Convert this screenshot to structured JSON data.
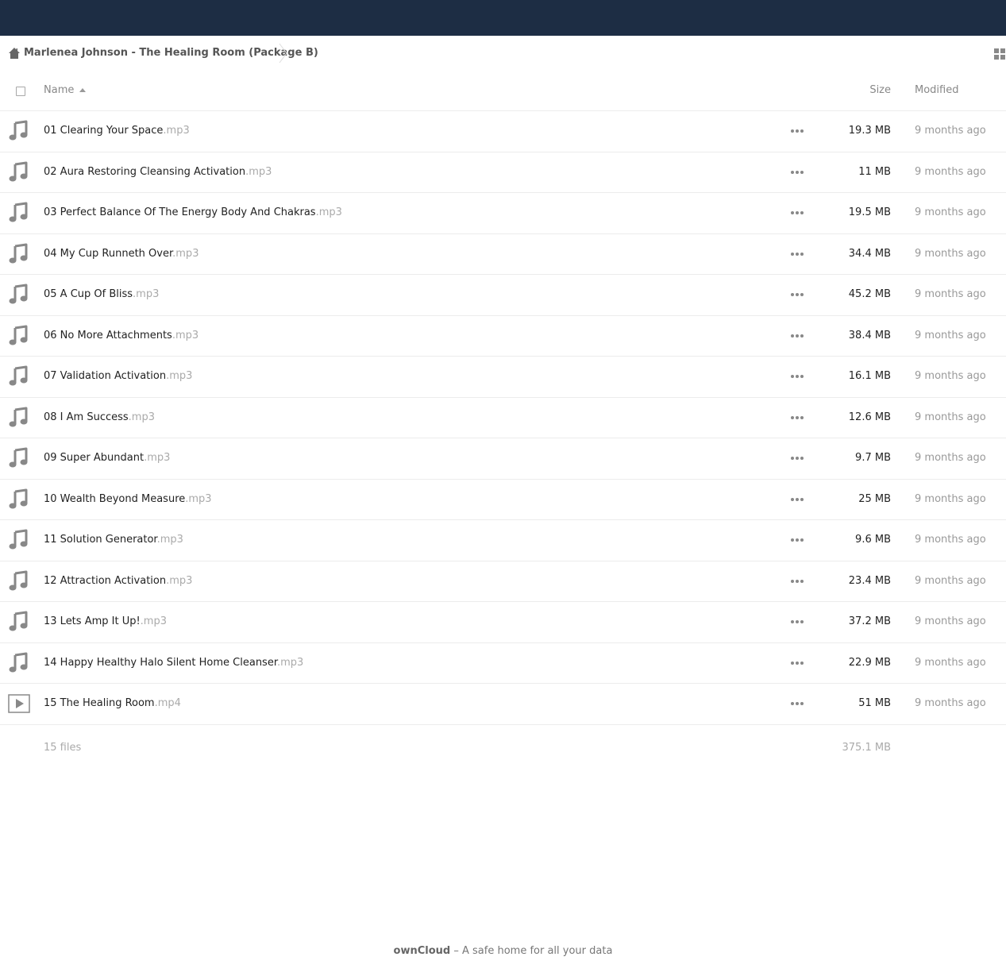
{
  "breadcrumb": {
    "home_icon": "home-icon",
    "folder": "Marlenea Johnson - The Healing Room (Package B)"
  },
  "table": {
    "headers": {
      "name": "Name",
      "size": "Size",
      "modified": "Modified"
    },
    "files": [
      {
        "name": "01 Clearing Your Space",
        "ext": ".mp3",
        "size": "19.3 MB",
        "modified": "9 months ago",
        "icon": "audio-file-icon"
      },
      {
        "name": "02 Aura Restoring Cleansing Activation",
        "ext": ".mp3",
        "size": "11 MB",
        "modified": "9 months ago",
        "icon": "audio-file-icon"
      },
      {
        "name": "03 Perfect Balance Of The Energy Body And Chakras",
        "ext": ".mp3",
        "size": "19.5 MB",
        "modified": "9 months ago",
        "icon": "audio-file-icon"
      },
      {
        "name": "04 My Cup Runneth Over",
        "ext": ".mp3",
        "size": "34.4 MB",
        "modified": "9 months ago",
        "icon": "audio-file-icon"
      },
      {
        "name": "05 A Cup Of Bliss",
        "ext": ".mp3",
        "size": "45.2 MB",
        "modified": "9 months ago",
        "icon": "audio-file-icon"
      },
      {
        "name": "06 No More Attachments",
        "ext": ".mp3",
        "size": "38.4 MB",
        "modified": "9 months ago",
        "icon": "audio-file-icon"
      },
      {
        "name": "07 Validation Activation",
        "ext": ".mp3",
        "size": "16.1 MB",
        "modified": "9 months ago",
        "icon": "audio-file-icon"
      },
      {
        "name": "08 I Am Success",
        "ext": ".mp3",
        "size": "12.6 MB",
        "modified": "9 months ago",
        "icon": "audio-file-icon"
      },
      {
        "name": "09 Super Abundant",
        "ext": ".mp3",
        "size": "9.7 MB",
        "modified": "9 months ago",
        "icon": "audio-file-icon"
      },
      {
        "name": "10 Wealth Beyond Measure",
        "ext": ".mp3",
        "size": "25 MB",
        "modified": "9 months ago",
        "icon": "audio-file-icon"
      },
      {
        "name": "11 Solution Generator",
        "ext": ".mp3",
        "size": "9.6 MB",
        "modified": "9 months ago",
        "icon": "audio-file-icon"
      },
      {
        "name": "12 Attraction Activation",
        "ext": ".mp3",
        "size": "23.4 MB",
        "modified": "9 months ago",
        "icon": "audio-file-icon"
      },
      {
        "name": "13 Lets Amp It Up!",
        "ext": ".mp3",
        "size": "37.2 MB",
        "modified": "9 months ago",
        "icon": "audio-file-icon"
      },
      {
        "name": "14 Happy Healthy Halo Silent Home Cleanser",
        "ext": ".mp3",
        "size": "22.9 MB",
        "modified": "9 months ago",
        "icon": "audio-file-icon"
      },
      {
        "name": "15 The Healing Room",
        "ext": ".mp4",
        "size": "51 MB",
        "modified": "9 months ago",
        "icon": "video-file-icon"
      }
    ]
  },
  "summary": {
    "count": "15 files",
    "total_size": "375.1 MB"
  },
  "footer": {
    "brand": "ownCloud",
    "tagline": " – A safe home for all your data"
  },
  "colors": {
    "topbar": "#1d2d44",
    "icon_gray": "#888888",
    "ext_gray": "#aaaaaa"
  }
}
